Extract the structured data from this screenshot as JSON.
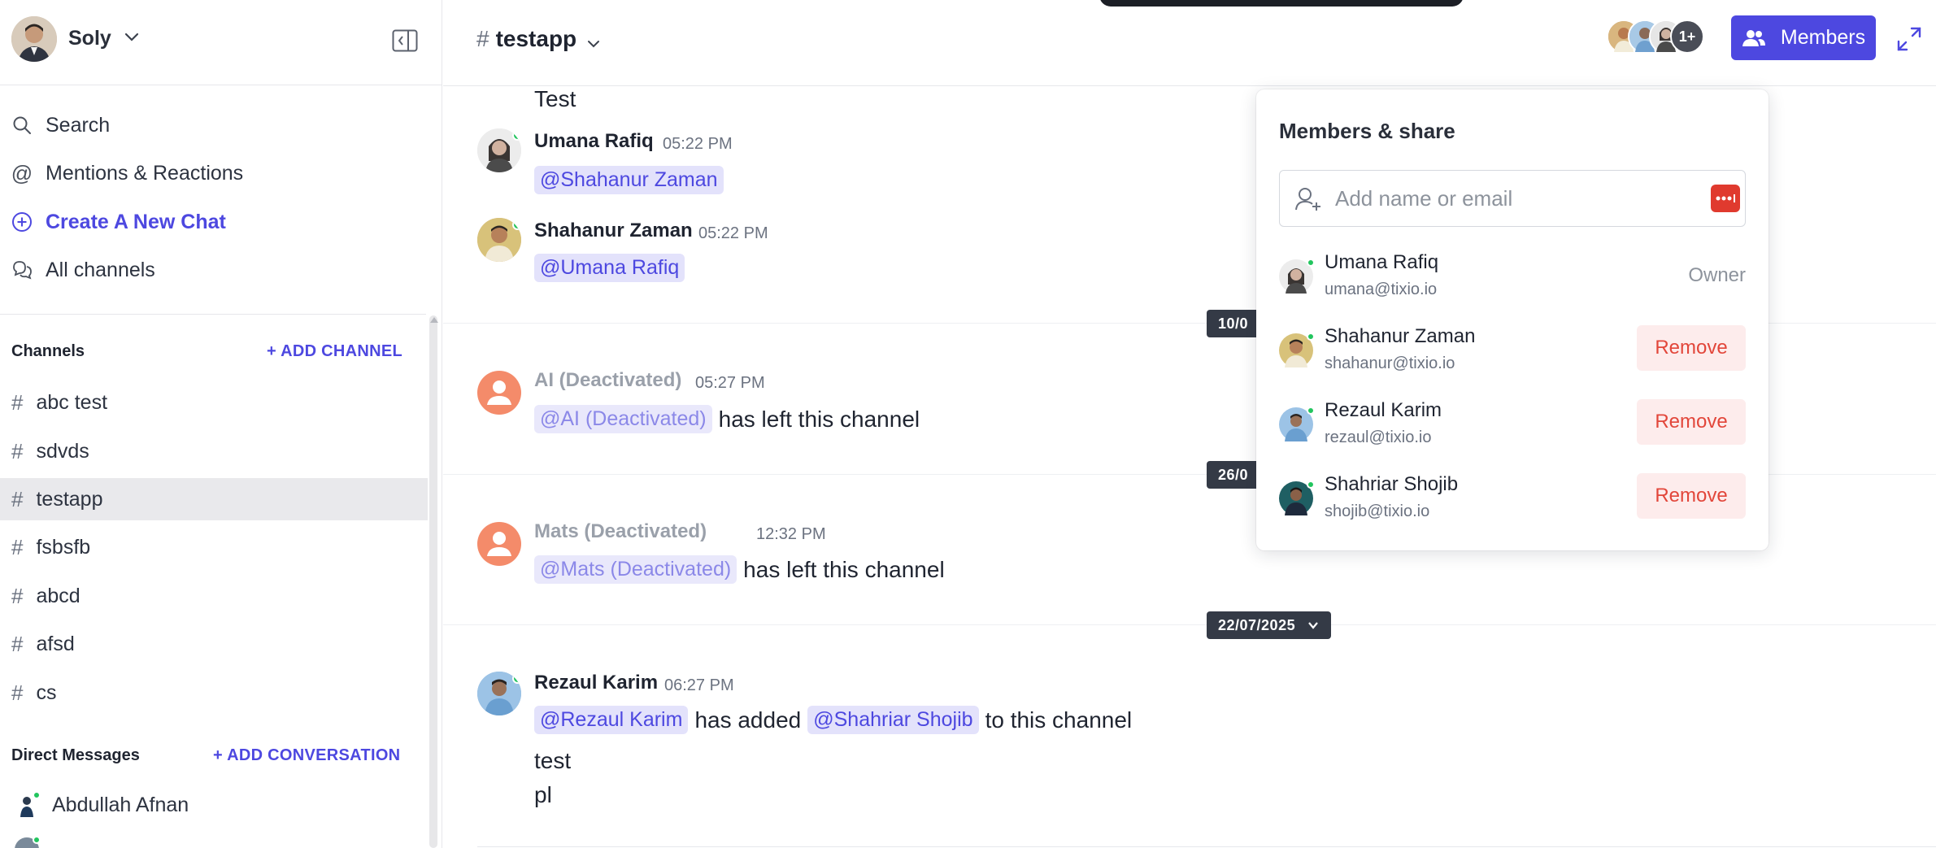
{
  "workspace": {
    "user_name": "Soly"
  },
  "sidebar": {
    "nav": [
      {
        "label": "Search",
        "icon": "search-icon"
      },
      {
        "label": "Mentions & Reactions",
        "icon": "at-icon"
      },
      {
        "label": "Create A New Chat",
        "icon": "plus-circle-icon"
      },
      {
        "label": "All channels",
        "icon": "chat-bubbles-icon"
      }
    ],
    "channels_title": "Channels",
    "add_channel": "+ ADD CHANNEL",
    "channels": [
      "abc test",
      "sdvds",
      "testapp",
      "fsbsfb",
      "abcd",
      "afsd",
      "cs"
    ],
    "active_channel": "testapp",
    "dm_title": "Direct Messages",
    "add_conversation": "+ ADD CONVERSATION",
    "dms": [
      "Abdullah Afnan"
    ]
  },
  "header": {
    "channel_name": "testapp",
    "members_more": "1+",
    "members_button": "Members"
  },
  "messages": {
    "leading_text": "Test",
    "items": [
      {
        "name": "Umana Rafiq",
        "time": "05:22 PM",
        "mention": "@Shahanur Zaman",
        "text": ""
      },
      {
        "name": "Shahanur Zaman",
        "time": "05:22 PM",
        "mention": "@Umana Rafiq",
        "text": ""
      },
      {
        "name": "AI (Deactivated)",
        "time": "05:27 PM",
        "mention": "@AI (Deactivated)",
        "text": "has left this channel"
      },
      {
        "name": "Mats (Deactivated)",
        "time": "12:32 PM",
        "mention": "@Mats (Deactivated)",
        "text": "has left this channel"
      },
      {
        "name": "Rezaul Karim",
        "time": "06:27 PM",
        "mention": "@Rezaul Karim",
        "text": "has added",
        "mention2": "@Shahriar Shojib",
        "text2": "to this channel",
        "extra": [
          "test",
          "pl"
        ]
      }
    ],
    "dates": [
      "10/0",
      "26/0",
      "22/07/2025"
    ]
  },
  "members_popover": {
    "title": "Members & share",
    "input_placeholder": "Add name or email",
    "members": [
      {
        "name": "Umana Rafiq",
        "email": "umana@tixio.io",
        "role": "Owner"
      },
      {
        "name": "Shahanur Zaman",
        "email": "shahanur@tixio.io",
        "action": "Remove"
      },
      {
        "name": "Rezaul Karim",
        "email": "rezaul@tixio.io",
        "action": "Remove"
      },
      {
        "name": "Shahriar Shojib",
        "email": "shojib@tixio.io",
        "action": "Remove"
      }
    ]
  },
  "colors": {
    "accent": "#4d48e0",
    "danger": "#e2463a",
    "online": "#22c55e"
  }
}
